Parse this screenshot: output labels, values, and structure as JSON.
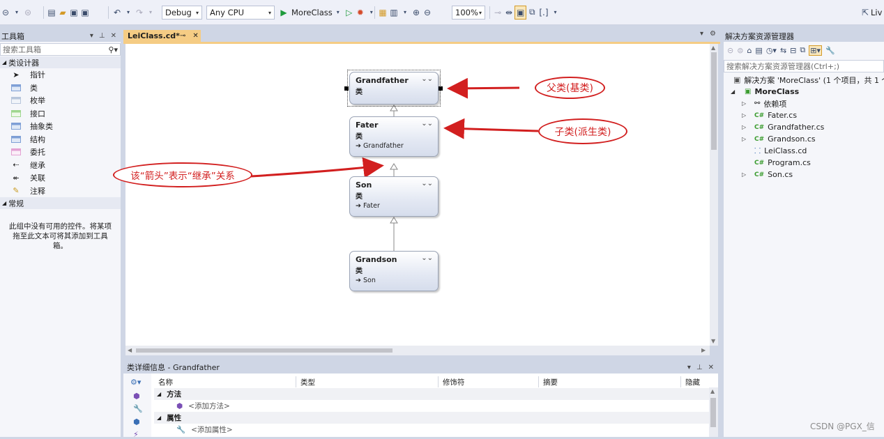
{
  "toolbar": {
    "config_value": "Debug",
    "platform_value": "Any CPU",
    "start_label": "MoreClass",
    "zoom_value": "100%",
    "live_label": "Liv"
  },
  "toolbox": {
    "title": "工具箱",
    "search_placeholder": "搜索工具箱",
    "group_class_designer": "类设计器",
    "items": [
      "指针",
      "类",
      "枚举",
      "接口",
      "抽象类",
      "结构",
      "委托",
      "继承",
      "关联",
      "注释"
    ],
    "group_general": "常规",
    "empty_message": "此组中没有可用的控件。将某项拖至此文本可将其添加到工具箱。"
  },
  "document": {
    "tab_label": "LeiClass.cd*"
  },
  "diagram": {
    "shapes": [
      {
        "name": "Grandfather",
        "kind": "类",
        "base": ""
      },
      {
        "name": "Fater",
        "kind": "类",
        "base": "Grandfather"
      },
      {
        "name": "Son",
        "kind": "类",
        "base": "Fater"
      },
      {
        "name": "Grandson",
        "kind": "类",
        "base": "Son"
      }
    ],
    "annotations": {
      "parent": "父类(基类)",
      "child": "子类(派生类)",
      "arrow_note": "该“箭头”表示“继承”关系"
    }
  },
  "details": {
    "title": "类详细信息 - Grandfather",
    "columns": [
      "名称",
      "类型",
      "修饰符",
      "摘要",
      "隐藏"
    ],
    "methods_group": "方法",
    "add_method": "<添加方法>",
    "properties_group": "属性",
    "add_property": "<添加属性>"
  },
  "solution_explorer": {
    "title": "解决方案资源管理器",
    "search_placeholder": "搜索解决方案资源管理器(Ctrl+;)",
    "solution_label": "解决方案 'MoreClass' (1 个项目，共 1 个",
    "project": "MoreClass",
    "items": [
      {
        "label": "依赖项",
        "icon": "dependencies-icon"
      },
      {
        "label": "Fater.cs",
        "icon": "csharp-file-icon"
      },
      {
        "label": "Grandfather.cs",
        "icon": "csharp-file-icon"
      },
      {
        "label": "Grandson.cs",
        "icon": "csharp-file-icon"
      },
      {
        "label": "LeiClass.cd",
        "icon": "class-diagram-icon"
      },
      {
        "label": "Program.cs",
        "icon": "csharp-file-icon"
      },
      {
        "label": "Son.cs",
        "icon": "csharp-file-icon"
      }
    ]
  },
  "watermark": "CSDN @PGX_信",
  "colors": {
    "accent_tab": "#f5cc84",
    "annotation_red": "#d21f1f",
    "chrome": "#cfd6e5"
  }
}
